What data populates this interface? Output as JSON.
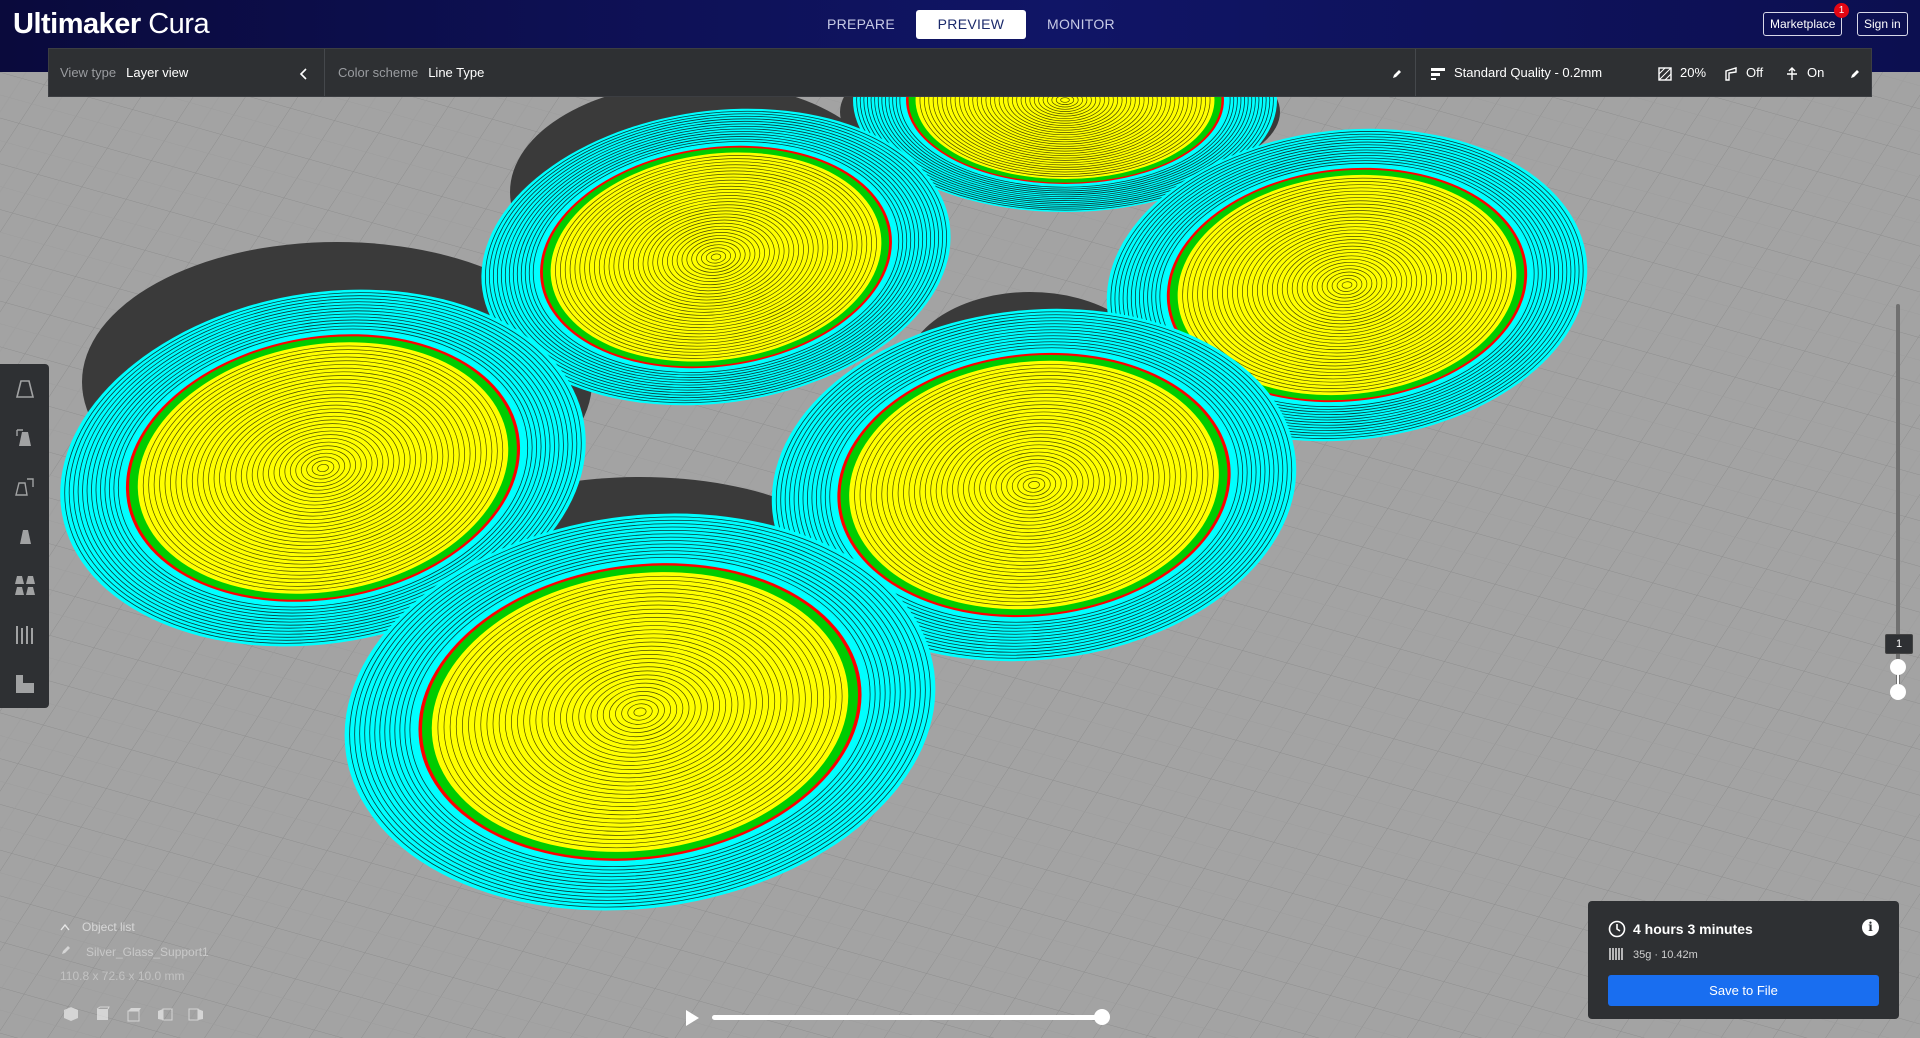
{
  "app": {
    "logo_bold": "Ultimaker",
    "logo_light": " Cura"
  },
  "header": {
    "stages": [
      {
        "label": "PREPARE",
        "active": false
      },
      {
        "label": "PREVIEW",
        "active": true
      },
      {
        "label": "MONITOR",
        "active": false
      }
    ],
    "marketplace_label": "Marketplace",
    "marketplace_badge": "1",
    "signin_label": "Sign in"
  },
  "settings_bar": {
    "view_type_label": "View type",
    "view_type_value": "Layer view",
    "color_scheme_label": "Color scheme",
    "color_scheme_value": "Line Type",
    "quality": "Standard Quality - 0.2mm",
    "infill": "20%",
    "support": "Off",
    "adhesion": "On"
  },
  "toolbar": {
    "tools": [
      "move-tool-icon",
      "scale-tool-icon",
      "rotate-tool-icon",
      "mirror-tool-icon",
      "per-model-settings-icon",
      "support-blocker-icon",
      "layer-icon"
    ]
  },
  "layer_slider": {
    "current_layer": "1"
  },
  "object_list": {
    "header": "Object list",
    "object_name": "Silver_Glass_Support1",
    "dimensions": "110.8 x 72.6 x 10.0 mm",
    "view_icons": [
      "3d-view-icon",
      "front-view-icon",
      "top-view-icon",
      "left-view-icon",
      "right-view-icon"
    ]
  },
  "print_info": {
    "time": "4 hours 3 minutes",
    "material": "35g · 10.42m",
    "save_label": "Save to File"
  },
  "colors": {
    "header_bg": "#101566",
    "panel_bg": "#2e3033",
    "accent_blue": "#196ef0",
    "skin": "#ffff00",
    "wall_outer": "#ff0000",
    "wall_inner": "#00cc00",
    "skirt": "#00ffff",
    "badge": "#e30613"
  }
}
